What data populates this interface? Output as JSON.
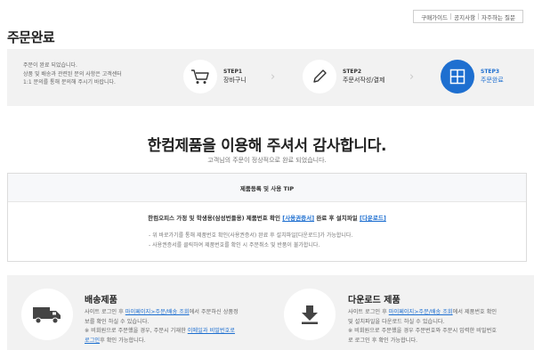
{
  "top_links": [
    "구매가이드",
    "공지사항",
    "자주하는 질문"
  ],
  "page_title": "주문완료",
  "band_message": [
    "주문이 완료 되었습니다.",
    "상품 및 배송과 관련된 문의 사항은 고객센터",
    "1:1 문의를 통해 문의해 주시기 바랍니다."
  ],
  "steps": [
    {
      "num": "STEP1",
      "label": "장바구니",
      "icon": "cart-icon"
    },
    {
      "num": "STEP2",
      "label": "주문서작성/결제",
      "icon": "pencil-icon"
    },
    {
      "num": "STEP3",
      "label": "주문완료",
      "icon": "grid-icon"
    }
  ],
  "thanks": {
    "title": "한컴제품을 이용해 주셔서 감사합니다.",
    "subtitle": "고객님의 주문이 정상적으로 완료 되었습니다."
  },
  "tip": {
    "header": "제품등록 및 사용 TIP",
    "main_prefix": "한컴오피스 가정 및 학생용(삼성번들용) 제품번호 확인 ",
    "main_link1": "[사용권증서]",
    "main_middle": " 완료 후 설치파일 ",
    "main_link2": "[다운로드]",
    "bullets": [
      "- 위 바로가기를 통해 제품번호 확인(사용권증서) 완료 후 설치파일[다운로드]가 가능합니다.",
      "- 사용권증서를 클릭하여 제품번호를 확인 시 주문취소 및 반품이 불가합니다."
    ]
  },
  "delivery": {
    "title": "배송제품",
    "line1_a": "사이트 로그인 후 ",
    "line1_link": "마이페이지>주문/배송 조회",
    "line1_b": "에서 주문하신 상품정",
    "line2": "보를 확인 하실 수 있습니다.",
    "line3_a": "※ 비회원으로 주문했을 경우, 주문시 기재한 ",
    "line3_link": "이메일과 비밀번호로",
    "line4_link": "로그인",
    "line4_b": "후 확인 가능합니다."
  },
  "download": {
    "title": "다운로드 제품",
    "line1_a": "사이트 로그인 후 ",
    "line1_link": "마이페이지>주문/배송 조회",
    "line1_b": "에서 제품번호 확인",
    "line2": "및 설치파일을 다운로드 하실 수 있습니다.",
    "line3": "※ 비회원으로 주문했을 경우 주문번호와 주문시 입력한 비밀번호",
    "line4": "로 로그인 후 확인 가능합니다."
  },
  "colors": {
    "accent": "#1e6fd0",
    "band": "#f2f2f2"
  }
}
